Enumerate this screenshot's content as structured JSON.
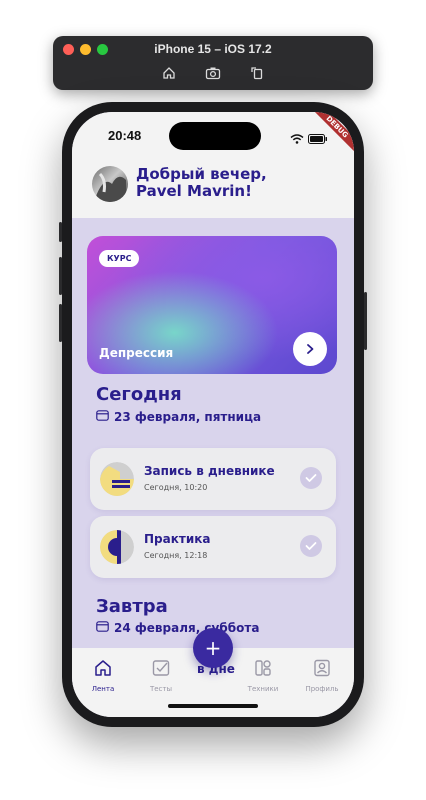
{
  "simulator": {
    "title": "iPhone 15 – iOS 17.2",
    "tools": [
      "home-icon",
      "screenshot-icon",
      "rotate-icon"
    ]
  },
  "status_bar": {
    "time": "20:48",
    "debug_banner": "DEBUG"
  },
  "header": {
    "greeting_line1": "Добрый вечер,",
    "greeting_line2": "Pavel Mavrin!"
  },
  "course_card": {
    "badge": "КУРС",
    "title": "Депрессия"
  },
  "today": {
    "title": "Сегодня",
    "date": "23 февраля, пятница",
    "entries": [
      {
        "title": "Запись в дневнике",
        "subtitle": "Сегодня, 10:20"
      },
      {
        "title": "Практика",
        "subtitle": "Сегодня, 12:18"
      }
    ]
  },
  "tomorrow": {
    "title": "Завтра",
    "date": "24 февраля, суббота",
    "peek_text": "в дне"
  },
  "tabbar": {
    "fab_label": "+",
    "tabs": [
      {
        "label": "Лента",
        "icon": "home-icon",
        "active": true
      },
      {
        "label": "Тесты",
        "icon": "tests-icon",
        "active": false
      },
      {
        "label": "Техники",
        "icon": "techniques-icon",
        "active": false
      },
      {
        "label": "Профиль",
        "icon": "profile-icon",
        "active": false
      }
    ]
  },
  "colors": {
    "accent": "#2a1e8c",
    "fab": "#3a2aa0",
    "background": "#d9d4ec"
  }
}
